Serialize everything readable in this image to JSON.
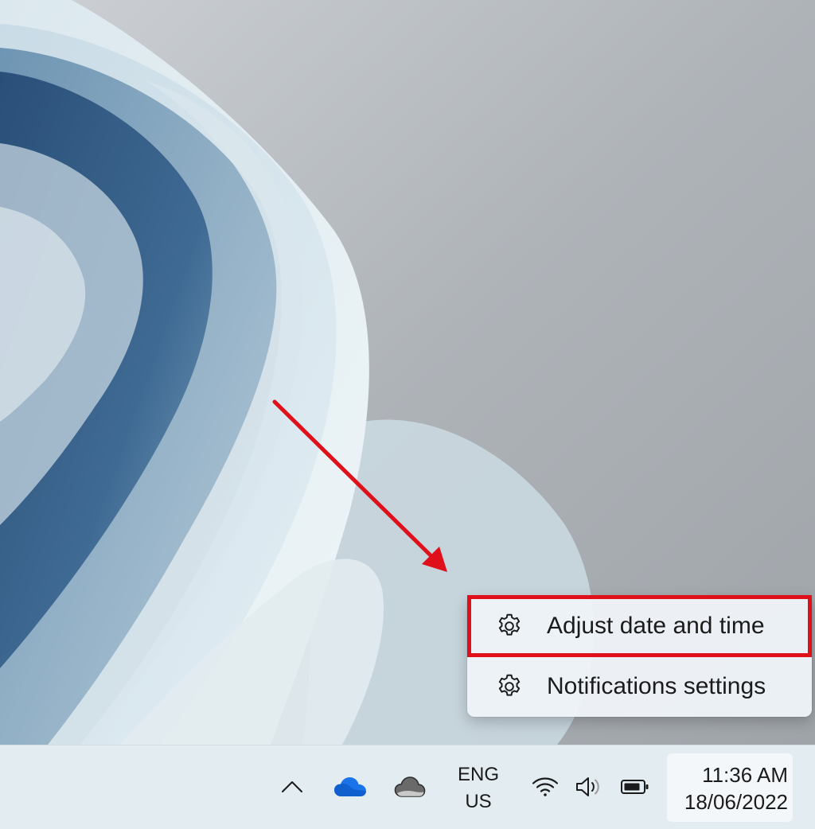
{
  "context_menu": {
    "items": [
      {
        "label": "Adjust date and time",
        "icon": "gear-icon",
        "highlighted": true
      },
      {
        "label": "Notifications settings",
        "icon": "gear-icon",
        "highlighted": false
      }
    ]
  },
  "taskbar": {
    "tray": {
      "show_hidden_icon": "chevron-up-icon",
      "onedrive_personal_icon": "onedrive-cloud-blue-icon",
      "onedrive_business_icon": "onedrive-cloud-gray-icon",
      "language_line1": "ENG",
      "language_line2": "US",
      "wifi_icon": "wifi-icon",
      "volume_icon": "volume-icon",
      "battery_icon": "battery-icon"
    },
    "clock": {
      "time": "11:36 AM",
      "date": "18/06/2022"
    }
  },
  "colors": {
    "annotation_red": "#e0101a",
    "onedrive_blue": "#1a73e8",
    "taskbar_bg": "#e3ecf1"
  }
}
